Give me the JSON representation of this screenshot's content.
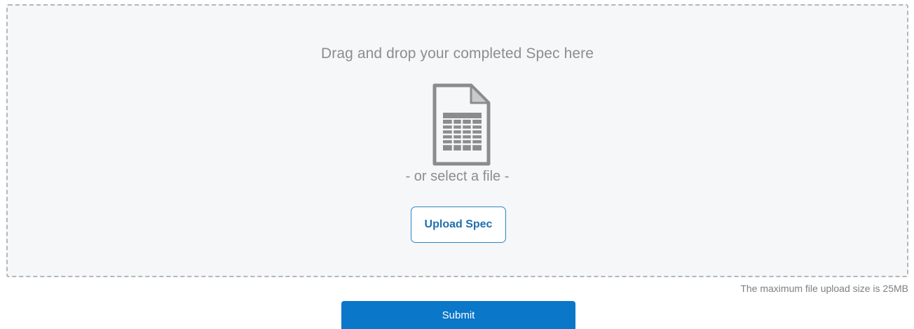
{
  "dropzone": {
    "title": "Drag and drop your completed Spec here",
    "icon": "spreadsheet-file-icon",
    "or_text": "- or select a file -",
    "upload_label": "Upload Spec"
  },
  "max_size_text": "The maximum file upload size is 25MB",
  "submit_label": "Submit",
  "colors": {
    "primary": "#0a77c8",
    "upload_border": "#2d84c4",
    "dropzone_bg": "#f6f7f9",
    "muted_text": "#8c8d8f"
  }
}
